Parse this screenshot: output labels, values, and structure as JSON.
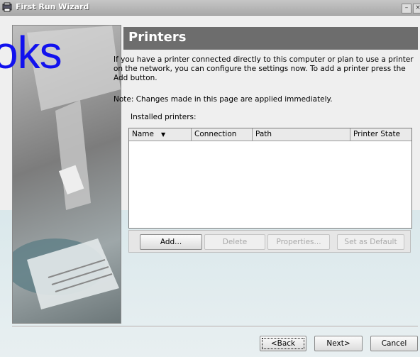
{
  "window": {
    "title": "First Run Wizard"
  },
  "overlay_text": "oks",
  "header": {
    "title": "Printers"
  },
  "description": "If you have a printer connected directly to this computer or plan to use a printer on the network, you can configure the settings now. To add a printer press the Add button.",
  "note": "Note: Changes made in this page are applied immediately.",
  "installed_printers_label": "Installed printers:",
  "table": {
    "columns": [
      "Name",
      "Connection",
      "Path",
      "Printer State"
    ],
    "rows": []
  },
  "buttons": {
    "add": "Add...",
    "delete": "Delete",
    "properties": "Properties...",
    "set_default": "Set as Default"
  },
  "nav": {
    "back": "<Back",
    "next": "Next>",
    "cancel": "Cancel"
  }
}
